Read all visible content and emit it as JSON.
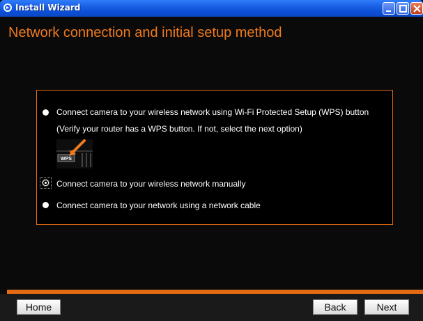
{
  "window": {
    "title": "Install Wizard"
  },
  "heading": "Network connection and initial setup method",
  "options": [
    {
      "label": "Connect camera to your wireless network using Wi-Fi Protected Setup (WPS) button",
      "sublabel": "(Verify your router has a WPS button. If not, select the next option)",
      "selected": false
    },
    {
      "label": "Connect camera to your wireless network manually",
      "selected": true
    },
    {
      "label": "Connect camera to your network using a network cable",
      "selected": false
    }
  ],
  "wps_image": {
    "text": "WPS"
  },
  "buttons": {
    "home": "Home",
    "back": "Back",
    "next": "Next"
  },
  "colors": {
    "accent": "#e16a14",
    "heading": "#f07a1e",
    "titlebar": "#1a5fe4"
  }
}
